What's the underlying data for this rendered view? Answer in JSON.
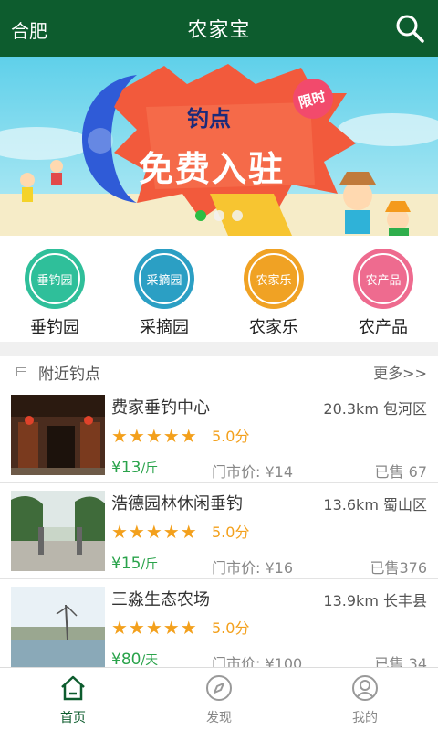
{
  "header": {
    "city": "合肥",
    "title": "农家宝",
    "icon": "search-icon"
  },
  "banner": {
    "line1": "钓点",
    "line2": "免费入驻",
    "tag": "限时",
    "dots_count": 3,
    "active_dot": 0
  },
  "categories": [
    {
      "icon_text": "垂钓园",
      "label": "垂钓园",
      "color": "#2fbf9a"
    },
    {
      "icon_text": "采摘园",
      "label": "采摘园",
      "color": "#2b9fc4"
    },
    {
      "icon_text": "农家乐",
      "label": "农家乐",
      "color": "#f0a224"
    },
    {
      "icon_text": "农产品",
      "label": "农产品",
      "color": "#ee6b8f"
    }
  ],
  "nearby": {
    "title": "附近钓点",
    "more": "更多>>"
  },
  "items": [
    {
      "name": "费家垂钓中心",
      "distance": "20.3km 包河区",
      "stars": "★★★★★",
      "score": "5.0分",
      "price": "¥13",
      "unit": "/斤",
      "market": "门市价: ¥14",
      "sold": "已售  67"
    },
    {
      "name": "浩德园林休闲垂钓",
      "distance": "13.6km 蜀山区",
      "stars": "★★★★★",
      "score": "5.0分",
      "price": "¥15",
      "unit": "/斤",
      "market": "门市价: ¥16",
      "sold": "已售376"
    },
    {
      "name": "三淼生态农场",
      "distance": "13.9km 长丰县",
      "stars": "★★★★★",
      "score": "5.0分",
      "price": "¥80",
      "unit": "/天",
      "market": "门市价: ¥100",
      "sold": "已售  34"
    }
  ],
  "tabs": [
    {
      "label": "首页",
      "icon": "home-icon",
      "active": true
    },
    {
      "label": "发现",
      "icon": "compass-icon",
      "active": false
    },
    {
      "label": "我的",
      "icon": "user-icon",
      "active": false
    }
  ],
  "colors": {
    "header_bg": "#0d5c2e",
    "accent_green": "#2aa34b",
    "star_orange": "#f3a01c"
  }
}
